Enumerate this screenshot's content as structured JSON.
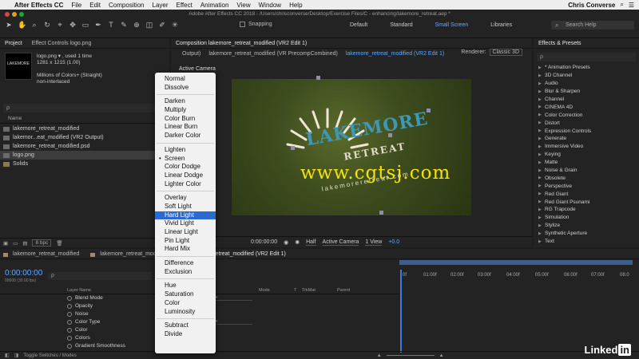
{
  "menubar": {
    "apple_icon": "",
    "app_name": "After Effects CC",
    "items": [
      "File",
      "Edit",
      "Composition",
      "Layer",
      "Effect",
      "Animation",
      "View",
      "Window",
      "Help"
    ],
    "user": "Chris Converse"
  },
  "toolbar": {
    "window_title": "Adobe After Effects CC 2018 - /Users/chrisconverse/Desktop/Exercise Files/C - enhancing/lakemore_retreat.aep *",
    "snapping_label": "Snapping",
    "workspaces": [
      "Default",
      "Standard",
      "Small Screen",
      "Libraries"
    ],
    "active_workspace": "Small Screen",
    "search_placeholder": "Search Help"
  },
  "project_panel": {
    "tabs": [
      "Project",
      "Effect Controls logo.png"
    ],
    "thumb_text": "LAKEMORE",
    "item_name": "logo.png ▾ , used 1 time",
    "item_size": "1281 x 1215 (1.00)",
    "item_colors": "Millions of Colors+ (Straight)",
    "item_interlace": "non-interlaced",
    "search_placeholder": "ρ",
    "col_name": "Name",
    "items": [
      {
        "name": "lakemore_retreat_modified"
      },
      {
        "name": "lakemor...eat_modified (VR2 Output)"
      },
      {
        "name": "lakemore_retreat_modified.psd"
      },
      {
        "name": "logo.png"
      },
      {
        "name": "Solids"
      }
    ],
    "bpc": "8 bpc"
  },
  "composition_panel": {
    "header": "Composition lakemore_retreat_modified (VR2 Edit 1)",
    "tabs": [
      "Output)",
      "lakemore_retreat_modified (VR PrecompCombined)",
      "lakemore_retreat_modified (VR2 Edit 1)"
    ],
    "renderer_label": "Renderer:",
    "renderer_value": "Classic 3D",
    "active_camera": "Active Camera",
    "logo_title": "LAKEMORE",
    "logo_retreat": "RETREAT",
    "logo_url": "lakemoreretreat.com",
    "watermark": "www.cgtsj.com",
    "footer": {
      "timecode": "0:00:00:00",
      "resolution": "Half",
      "view": "Active Camera",
      "views": "1 View",
      "offset": "+0.0"
    }
  },
  "effects_panel": {
    "title": "Effects & Presets",
    "search_placeholder": "ρ",
    "items": [
      "* Animation Presets",
      "3D Channel",
      "Audio",
      "Blur & Sharpen",
      "Channel",
      "CINEMA 4D",
      "Color Correction",
      "Distort",
      "Expression Controls",
      "Generate",
      "Immersive Video",
      "Keying",
      "Matte",
      "Noise & Grain",
      "Obsolete",
      "Perspective",
      "Red Giant",
      "Red Giant Psunami",
      "RG Trapcode",
      "Simulation",
      "Stylize",
      "Synthetic Aperture",
      "Text"
    ]
  },
  "timeline": {
    "tabs": [
      "lakemore_retreat_modified",
      "lakemore_retreat_modified",
      "lakemore_retreat_modified (VR2 Edit 1)"
    ],
    "timecode": "0:00:00:00",
    "fps": "00000 (30.00 fps)",
    "search_placeholder": "ρ",
    "columns": [
      "Layer Name",
      "Mode",
      "T",
      "TrkMat",
      "Parent"
    ],
    "properties": [
      "Blend Mode",
      "Opacity",
      "Noise",
      "Color Type",
      "Color",
      "Colors",
      "Gradient Smoothness"
    ],
    "ruler_ticks": [
      "0f",
      "01:00f",
      "02:00f",
      "03:00f",
      "04:00f",
      "05:00f",
      "06:00f",
      "07:00f",
      "08:0"
    ],
    "footer_toggle": "Toggle Switches / Modes"
  },
  "blend_menu": {
    "groups": [
      [
        "Normal",
        "Dissolve"
      ],
      [
        "Darken",
        "Multiply",
        "Color Burn",
        "Linear Burn",
        "Darker Color"
      ],
      [
        "Lighten",
        "Screen",
        "Color Dodge",
        "Linear Dodge",
        "Lighter Color"
      ],
      [
        "Overlay",
        "Soft Light",
        "Hard Light",
        "Vivid Light",
        "Linear Light",
        "Pin Light",
        "Hard Mix"
      ],
      [
        "Difference",
        "Exclusion"
      ],
      [
        "Hue",
        "Saturation",
        "Color",
        "Luminosity"
      ],
      [
        "Subtract",
        "Divide"
      ]
    ],
    "checked": "Screen",
    "highlighted": "Hard Light"
  },
  "watermark_brand": "Linked",
  "watermark_brand_in": "in",
  "colors": {
    "accent_blue": "#5fa8ff",
    "selection_blue": "#2a6ad1",
    "watermark_yellow": "#f3e30b",
    "logo_teal": "#3e98b5"
  }
}
